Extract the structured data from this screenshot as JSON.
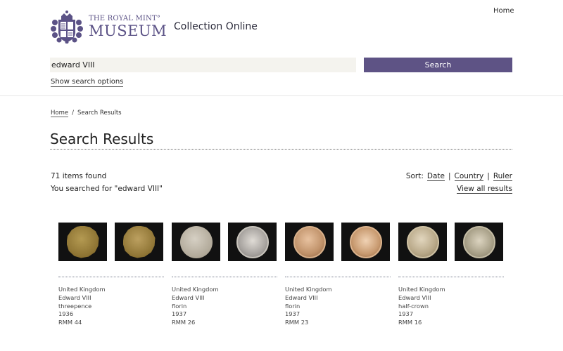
{
  "header": {
    "logo_line1": "THE ROYAL MINT°",
    "logo_line2": "MUSEUM",
    "subtitle": "Collection Online",
    "nav_home": "Home"
  },
  "search": {
    "value": "edward VIII",
    "button_label": "Search",
    "options_link": "Show search options"
  },
  "breadcrumb": {
    "home": "Home",
    "separator": "/",
    "current": "Search Results"
  },
  "page_title": "Search Results",
  "summary": {
    "count": "71 items found",
    "query": "You searched for \"edward VIII\""
  },
  "sort": {
    "label": "Sort:",
    "options": [
      "Date",
      "Country",
      "Ruler"
    ],
    "separator": "|",
    "view_all": "View all results"
  },
  "colors": {
    "brand": "#5e5385"
  },
  "results": [
    {
      "country": "United Kingdom",
      "ruler": "Edward VIII",
      "denomination": "threepence",
      "year": "1936",
      "ref": "RMM 44",
      "images": [
        "brass dodecagonal coin obverse 'MODEL'",
        "brass dodecagonal coin reverse star 'ROYAL MINT'"
      ]
    },
    {
      "country": "United Kingdom",
      "ruler": "Edward VIII",
      "denomination": "florin",
      "year": "1937",
      "ref": "RMM 26",
      "images": [
        "silver blank obverse",
        "silver coin reverse crowned rose"
      ]
    },
    {
      "country": "United Kingdom",
      "ruler": "Edward VIII",
      "denomination": "florin",
      "year": "1937",
      "ref": "RMM 23",
      "images": [
        "copper-toned coin obverse portrait",
        "copper-toned coin reverse crowned rose"
      ]
    },
    {
      "country": "United Kingdom",
      "ruler": "Edward VIII",
      "denomination": "half-crown",
      "year": "1937",
      "ref": "RMM 16",
      "images": [
        "silver-toned coin obverse portrait",
        "silver-toned coin reverse shield"
      ]
    }
  ]
}
